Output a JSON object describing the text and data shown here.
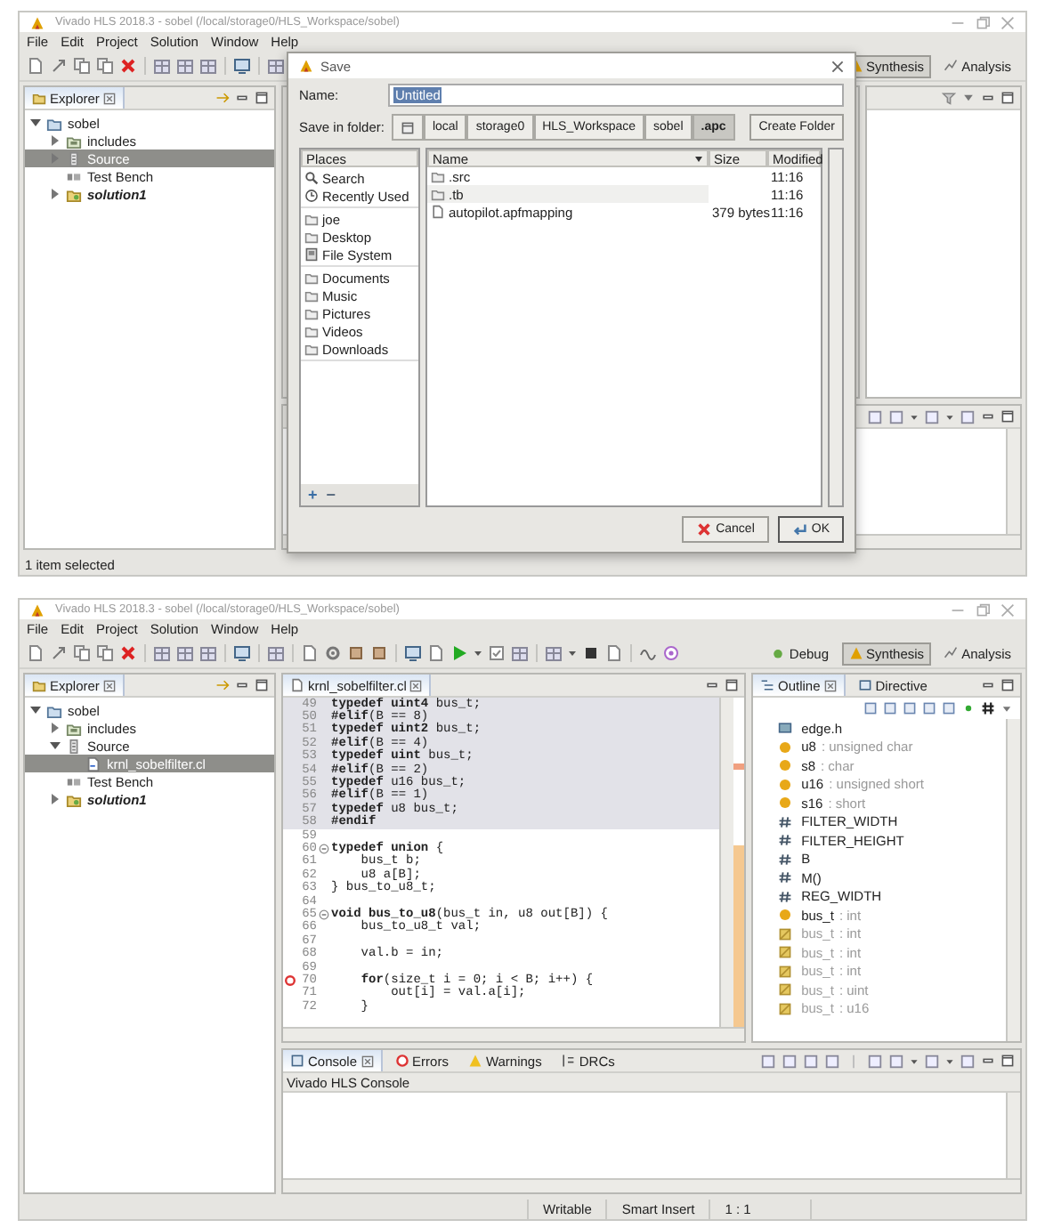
{
  "screens": [
    {
      "window": {
        "title": "Vivado HLS 2018.3 - sobel (/local/storage0/HLS_Workspace/sobel)"
      },
      "menu": [
        "File",
        "Edit",
        "Project",
        "Solution",
        "Window",
        "Help"
      ],
      "perspectives": [
        {
          "label": "Synthesis",
          "kind": "synthesis",
          "selected": true
        },
        {
          "label": "Analysis",
          "kind": "analysis",
          "selected": false
        }
      ],
      "explorer": {
        "title": "Explorer",
        "tree": [
          {
            "label": "sobel",
            "kind": "project",
            "expanded": true,
            "selected": false,
            "children": [
              {
                "label": "includes",
                "kind": "includes",
                "expanded": false,
                "selected": false
              },
              {
                "label": "Source",
                "kind": "source",
                "expanded": false,
                "selected": true
              },
              {
                "label": "Test Bench",
                "kind": "testbench",
                "selected": false
              },
              {
                "label": "solution1",
                "kind": "solution",
                "expanded": false,
                "selected": false
              }
            ]
          }
        ]
      },
      "dialog": {
        "title": "Save",
        "name_label": "Name:",
        "name_value": "Untitled",
        "folder_label": "Save in folder:",
        "path": [
          {
            "label": "local",
            "selected": false
          },
          {
            "label": "storage0",
            "selected": false
          },
          {
            "label": "HLS_Workspace",
            "selected": false
          },
          {
            "label": "sobel",
            "selected": false
          },
          {
            "label": ".apc",
            "selected": true
          }
        ],
        "create_folder": "Create Folder",
        "places_heading": "Places",
        "place_groups": [
          {
            "items": [
              {
                "label": "Search",
                "kind": "search"
              },
              {
                "label": "Recently Used",
                "kind": "recent"
              }
            ]
          },
          {
            "items": [
              {
                "label": "joe",
                "kind": "folder"
              },
              {
                "label": "Desktop",
                "kind": "folder"
              },
              {
                "label": "File System",
                "kind": "drive"
              }
            ]
          },
          {
            "items": [
              {
                "label": "Documents",
                "kind": "folder"
              },
              {
                "label": "Music",
                "kind": "folder"
              },
              {
                "label": "Pictures",
                "kind": "folder"
              },
              {
                "label": "Videos",
                "kind": "folder"
              },
              {
                "label": "Downloads",
                "kind": "folder"
              }
            ]
          }
        ],
        "place_buttons": [
          "+",
          "−"
        ],
        "columns": [
          "Name",
          "Size",
          "Modified"
        ],
        "files": [
          {
            "name": ".src",
            "kind": "folder",
            "modified": "11:16"
          },
          {
            "name": ".tb",
            "kind": "folder",
            "modified": "11:16"
          },
          {
            "name": "autopilot.apfmapping",
            "kind": "file",
            "size": "379 bytes",
            "modified": "11:16"
          }
        ],
        "buttons": [
          {
            "label": "Cancel",
            "kind": "cancel"
          },
          {
            "label": "OK",
            "kind": "ok"
          }
        ]
      },
      "status_bar": [
        "1 item selected"
      ]
    },
    {
      "window": {
        "title": "Vivado HLS 2018.3 - sobel (/local/storage0/HLS_Workspace/sobel)"
      },
      "menu": [
        "File",
        "Edit",
        "Project",
        "Solution",
        "Window",
        "Help"
      ],
      "perspectives": [
        {
          "label": "Debug",
          "kind": "debug",
          "selected": false
        },
        {
          "label": "Synthesis",
          "kind": "synthesis",
          "selected": true
        },
        {
          "label": "Analysis",
          "kind": "analysis",
          "selected": false
        }
      ],
      "explorer": {
        "title": "Explorer",
        "tree": [
          {
            "label": "sobel",
            "kind": "project",
            "expanded": true,
            "selected": false,
            "children": [
              {
                "label": "includes",
                "kind": "includes",
                "expanded": false,
                "selected": false
              },
              {
                "label": "Source",
                "kind": "source",
                "expanded": true,
                "selected": false,
                "children": [
                  {
                    "label": "krnl_sobelfilter.cl",
                    "kind": "file",
                    "selected": true
                  }
                ]
              },
              {
                "label": "Test Bench",
                "kind": "testbench",
                "selected": false
              },
              {
                "label": "solution1",
                "kind": "solution",
                "expanded": false,
                "selected": false
              }
            ]
          }
        ]
      },
      "editor": {
        "tab": "krnl_sobelfilter.cl",
        "lines": [
          {
            "number": "49",
            "text": "**typedef** **uint4** bus_t;",
            "inactive": true,
            "kind": "plain"
          },
          {
            "number": "50",
            "text": "**#elif**(B == 8)",
            "inactive": true,
            "kind": "plain"
          },
          {
            "number": "51",
            "text": "**typedef** **uint2** bus_t;",
            "inactive": true,
            "kind": "plain"
          },
          {
            "number": "52",
            "text": "**#elif**(B == 4)",
            "inactive": true,
            "kind": "plain"
          },
          {
            "number": "53",
            "text": "**typedef** **uint** bus_t;",
            "inactive": true,
            "kind": "plain"
          },
          {
            "number": "54",
            "text": "**#elif**(B == 2)",
            "inactive": true,
            "kind": "plain"
          },
          {
            "number": "55",
            "text": "**typedef** u16 bus_t;",
            "inactive": true,
            "kind": "plain"
          },
          {
            "number": "56",
            "text": "**#elif**(B == 1)",
            "inactive": true,
            "kind": "plain"
          },
          {
            "number": "57",
            "text": "**typedef** u8 bus_t;",
            "inactive": true,
            "kind": "plain"
          },
          {
            "number": "58",
            "text": "**#endif**",
            "inactive": true,
            "kind": "plain"
          },
          {
            "number": "59",
            "inactive": false,
            "kind": "plain"
          },
          {
            "number": "60",
            "text": "**typedef** **union** {",
            "inactive": false,
            "kind": "fold"
          },
          {
            "number": "61",
            "text": "    bus_t b;",
            "inactive": false,
            "kind": "plain"
          },
          {
            "number": "62",
            "text": "    u8 a[B];",
            "inactive": false,
            "kind": "plain"
          },
          {
            "number": "63",
            "text": "} bus_to_u8_t;",
            "inactive": false,
            "kind": "plain"
          },
          {
            "number": "64",
            "inactive": false,
            "kind": "plain"
          },
          {
            "number": "65",
            "text": "**void** **bus_to_u8**(bus_t in, u8 out[B]) {",
            "inactive": false,
            "kind": "fold"
          },
          {
            "number": "66",
            "text": "    bus_to_u8_t val;",
            "inactive": false,
            "kind": "plain"
          },
          {
            "number": "67",
            "inactive": false,
            "kind": "plain"
          },
          {
            "number": "68",
            "text": "    val.b = in;",
            "inactive": false,
            "kind": "plain"
          },
          {
            "number": "69",
            "inactive": false,
            "kind": "plain"
          },
          {
            "number": "70",
            "text": "    **for**(size_t i = 0; i < B; i++) {",
            "inactive": false,
            "kind": "error"
          },
          {
            "number": "71",
            "text": "        out[i] = val.a[i];",
            "inactive": false,
            "kind": "plain"
          },
          {
            "number": "72",
            "text": "    }",
            "inactive": false,
            "kind": "plain"
          }
        ]
      },
      "outline": {
        "tabs": [
          {
            "label": "Outline",
            "kind": "outline",
            "selected": true
          },
          {
            "label": "Directive",
            "kind": "directive",
            "selected": false
          }
        ],
        "items": [
          {
            "name": "edge.h",
            "kind": "include",
            "disabled": false
          },
          {
            "name": "u8",
            "type": ": unsigned char",
            "kind": "typedef",
            "disabled": false
          },
          {
            "name": "s8",
            "type": ": char",
            "kind": "typedef",
            "disabled": false
          },
          {
            "name": "u16",
            "type": ": unsigned short",
            "kind": "typedef",
            "disabled": false
          },
          {
            "name": "s16",
            "type": ": short",
            "kind": "typedef",
            "disabled": false
          },
          {
            "name": "FILTER_WIDTH",
            "kind": "macro",
            "disabled": false
          },
          {
            "name": "FILTER_HEIGHT",
            "kind": "macro",
            "disabled": false
          },
          {
            "name": "B",
            "kind": "macro",
            "disabled": false
          },
          {
            "name": "M()",
            "kind": "macro",
            "disabled": false
          },
          {
            "name": "REG_WIDTH",
            "kind": "macro",
            "disabled": false
          },
          {
            "name": "bus_t",
            "type": ": int",
            "kind": "typedef",
            "disabled": false
          },
          {
            "name": "bus_t",
            "type": ": int",
            "kind": "typedef",
            "disabled": true
          },
          {
            "name": "bus_t",
            "type": ": int",
            "kind": "typedef",
            "disabled": true
          },
          {
            "name": "bus_t",
            "type": ": int",
            "kind": "typedef",
            "disabled": true
          },
          {
            "name": "bus_t",
            "type": ": uint",
            "kind": "typedef",
            "disabled": true
          },
          {
            "name": "bus_t",
            "type": ": u16",
            "kind": "typedef",
            "disabled": true
          }
        ]
      },
      "console": {
        "tabs": [
          {
            "label": "Console",
            "kind": "console",
            "selected": true
          },
          {
            "label": "Errors",
            "kind": "errors",
            "selected": false
          },
          {
            "label": "Warnings",
            "kind": "warnings",
            "selected": false
          },
          {
            "label": "DRCs",
            "kind": "drcs",
            "selected": false
          }
        ],
        "title": "Vivado HLS Console"
      },
      "status_bar": [
        "Writable",
        "Smart Insert",
        "1 : 1"
      ]
    }
  ]
}
